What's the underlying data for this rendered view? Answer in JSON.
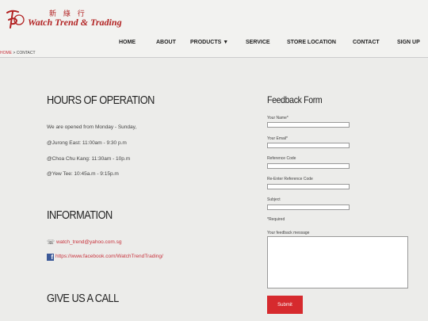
{
  "brand": {
    "chinese": "新 綠 行",
    "name": "Watch  Trend & Trading",
    "mark": "TP",
    "color": "#b22222"
  },
  "nav": {
    "home": "HOME",
    "about": "ABOUT",
    "products": "PRODUCTS ▼",
    "service": "SERVICE",
    "store_location": "STORE LOCATION",
    "contact": "CONTACT",
    "sign_up": "SIGN UP"
  },
  "breadcrumb": {
    "home": "HOME",
    "separator": " > ",
    "current": "CONTACT"
  },
  "hours": {
    "heading": "HOURS OF OPERATION",
    "lines": [
      "We are opened from Monday - Sunday,",
      "@Jurong East: 11:00am - 9:30 p.m",
      "@Choa Chu Kang: 11:30am - 10p.m",
      "@Yew Tee: 10:45a.m - 9:15p.m"
    ]
  },
  "information": {
    "heading": "INFORMATION",
    "email": "watch_trend@yahoo.com.sg",
    "facebook": "https://www.facebook.com/WatchTrendTrading/"
  },
  "call": {
    "heading": "GIVE US A CALL"
  },
  "feedback": {
    "title": "Feedback Form",
    "your_name": "Your Name*",
    "your_email": "Your Email*",
    "reference_code": "Reference Code",
    "re_enter_reference_code": "Re-Enter Reference Code",
    "subject": "Subject",
    "required_note": "*Required",
    "message_label": "Your feedback message",
    "submit": "Submit"
  },
  "colors": {
    "accent": "#c8333d",
    "submit_bg": "#d62a2e",
    "facebook": "#3b5998"
  }
}
